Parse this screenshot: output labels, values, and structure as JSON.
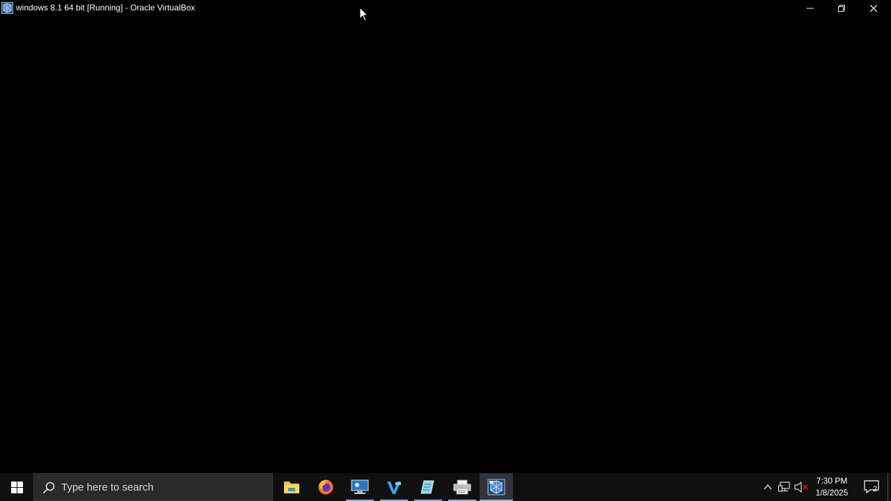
{
  "window": {
    "title": "windows 8.1 64 bit [Running] - Oracle VirtualBox",
    "app_icon": "virtualbox-icon",
    "controls": [
      "minimize-icon",
      "restore-icon",
      "close-icon"
    ]
  },
  "taskbar": {
    "start_icon": "windows-logo-icon",
    "search": {
      "placeholder": "Type here to search",
      "icon": "search-icon"
    },
    "apps": [
      {
        "name": "file-explorer",
        "icon": "folder-icon"
      },
      {
        "name": "firefox",
        "icon": "firefox-icon"
      },
      {
        "name": "remote-desktop",
        "icon": "monitor-icon"
      },
      {
        "name": "visual-studio",
        "icon": "visual-studio-icon"
      },
      {
        "name": "notepad-app",
        "icon": "notepad-icon"
      },
      {
        "name": "printer-app",
        "icon": "printer-icon"
      },
      {
        "name": "virtualbox",
        "icon": "virtualbox-icon"
      }
    ],
    "tray": {
      "icons": [
        "chevron-up-icon",
        "network-icon",
        "volume-muted-icon"
      ],
      "time": "7:30 PM",
      "date": "1/8/2025",
      "notifications_count": "2"
    }
  },
  "colors": {
    "background": "#000000",
    "taskbar": "#101010",
    "accent": "#76b9ed"
  }
}
